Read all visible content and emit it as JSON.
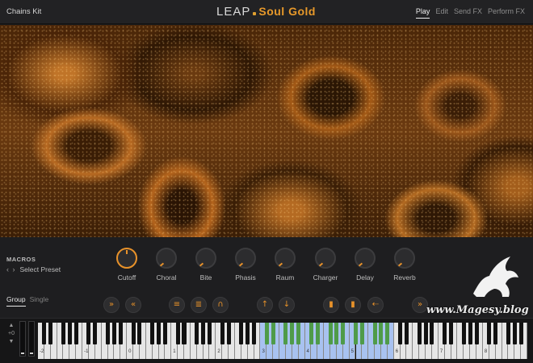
{
  "header": {
    "preset": "Chains Kit",
    "logo_brand": "LEAP",
    "logo_product": "Soul Gold",
    "tabs": [
      "Play",
      "Edit",
      "Send FX",
      "Perform FX"
    ],
    "active_tab": "Play"
  },
  "macros": {
    "title": "MACROS",
    "select_preset": "Select Preset",
    "knobs": [
      {
        "label": "Cutoff",
        "value": 0.5
      },
      {
        "label": "Choral",
        "value": 0
      },
      {
        "label": "Bite",
        "value": 0
      },
      {
        "label": "Phasis",
        "value": 0
      },
      {
        "label": "Raum",
        "value": 0
      },
      {
        "label": "Charger",
        "value": 0
      },
      {
        "label": "Delay",
        "value": 0
      },
      {
        "label": "Reverb",
        "value": 0
      }
    ]
  },
  "mode_tabs": [
    "Group",
    "Single"
  ],
  "active_mode": "Group",
  "toolbar": {
    "buttons": [
      {
        "name": "fast-forward-icon",
        "glyph": "»"
      },
      {
        "name": "rewind-icon",
        "glyph": "«"
      },
      {
        "name": "chord-icon",
        "glyph": "≡"
      },
      {
        "name": "arpeggio-icon",
        "glyph": "≣"
      },
      {
        "name": "wave-icon",
        "glyph": "∩"
      },
      {
        "name": "arrow-up-icon",
        "glyph": "↑"
      },
      {
        "name": "arrow-down-icon",
        "glyph": "↓"
      },
      {
        "name": "bars-icon",
        "glyph": "▮"
      },
      {
        "name": "columns-icon",
        "glyph": "▮"
      },
      {
        "name": "scatter-icon",
        "glyph": "⇠"
      },
      {
        "name": "skip-icon",
        "glyph": "»"
      }
    ]
  },
  "keyboard": {
    "octave_value": "+0",
    "octave_labels": [
      "-2",
      "-1",
      "0",
      "1",
      "2",
      "3",
      "4",
      "5",
      "6",
      "7",
      "8"
    ],
    "highlight_range": [
      "3",
      "5"
    ]
  },
  "watermark": "www.Magesy.blog",
  "colors": {
    "accent": "#e8922a",
    "highlight_white": "#a8c2f0",
    "highlight_black": "#4f9b49"
  }
}
